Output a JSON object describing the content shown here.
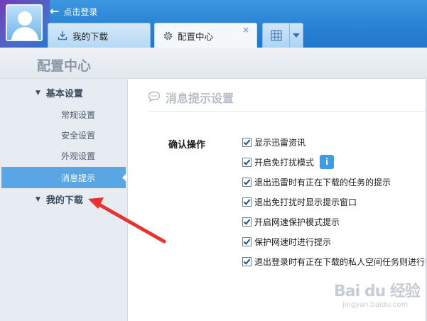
{
  "topbar": {
    "login_label": "点击登录",
    "tabs": [
      {
        "label": "我的下载"
      },
      {
        "label": "配置中心",
        "close": "×"
      }
    ]
  },
  "header": {
    "title": "配置中心"
  },
  "sidebar": {
    "groups": [
      {
        "label": "基本设置",
        "expanded": true,
        "items": [
          "常规设置",
          "安全设置",
          "外观设置",
          "消息提示"
        ]
      },
      {
        "label": "我的下载",
        "expanded": false
      }
    ],
    "active_item": "消息提示"
  },
  "main": {
    "section_title": "消息提示设置",
    "group_label": "确认操作",
    "options": [
      {
        "label": "显示迅雷资讯",
        "checked": true
      },
      {
        "label": "开启免打扰模式",
        "checked": true,
        "info": "i"
      },
      {
        "label": "退出迅雷时有正在下载的任务的提示",
        "checked": true
      },
      {
        "label": "退出免打扰时显示提示窗口",
        "checked": true
      },
      {
        "label": "开启网速保护模式提示",
        "checked": true
      },
      {
        "label": "保护网速时进行提示",
        "checked": true
      },
      {
        "label": "退出登录时有正在下载的私人空间任务则进行提示",
        "checked": true
      }
    ]
  },
  "watermark": {
    "brand": "Bai du 经验",
    "url": "jingyan.baidu.com"
  },
  "colors": {
    "accent": "#5aa5e3",
    "annotation": "#e8322f",
    "titlebar": "#2a82d4"
  }
}
